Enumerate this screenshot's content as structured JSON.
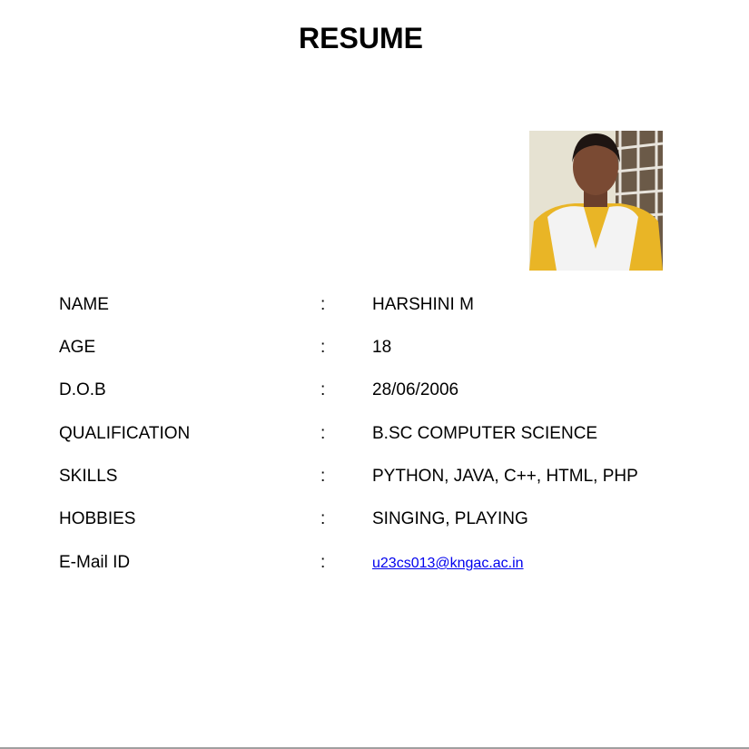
{
  "title": "RESUME",
  "photo": {
    "description_icon": "portrait-photo"
  },
  "fields": [
    {
      "label": "NAME",
      "sep": ":",
      "value": "HARSHINI M"
    },
    {
      "label": "AGE",
      "sep": ":",
      "value": "18"
    },
    {
      "label": "D.O.B",
      "sep": ":",
      "value": "28/06/2006"
    },
    {
      "label": "QUALIFICATION",
      "sep": ":",
      "value": "B.SC COMPUTER SCIENCE"
    },
    {
      "label": "SKILLS",
      "sep": ":",
      "value": "PYTHON, JAVA, C++, HTML, PHP"
    },
    {
      "label": "HOBBIES",
      "sep": ":",
      "value": "SINGING, PLAYING"
    },
    {
      "label": "E-Mail ID",
      "sep": ":",
      "value": "u23cs013@kngac.ac.in"
    }
  ],
  "colors": {
    "link": "#0000ee"
  }
}
